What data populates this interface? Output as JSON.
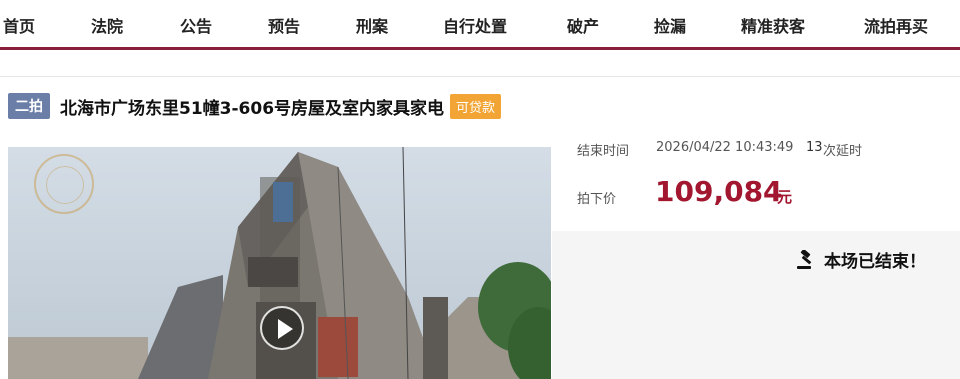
{
  "nav": {
    "items": [
      "首页",
      "法院",
      "公告",
      "预告",
      "刑案",
      "自行处置",
      "破产",
      "捡漏",
      "精准获客",
      "流拍再买"
    ]
  },
  "lot": {
    "round_badge": "二拍",
    "title": "北海市广场东里51幢3-606号房屋及室内家具家电",
    "loan_tag": "可贷款"
  },
  "info": {
    "end_time_label": "结束时间",
    "end_time_value": "2026/04/22 10:43:49",
    "delay_count": "13",
    "delay_suffix": "次延时",
    "price_label": "拍下价",
    "price_value": "109,084",
    "price_unit": "元"
  },
  "status": {
    "ended_text": "本场已结束！"
  },
  "colors": {
    "brand": "#8a1f3d",
    "price": "#a2172f",
    "round_badge": "#6b7ea8",
    "loan_tag": "#f2a534"
  },
  "icons": [
    "play-icon",
    "gavel-icon"
  ]
}
